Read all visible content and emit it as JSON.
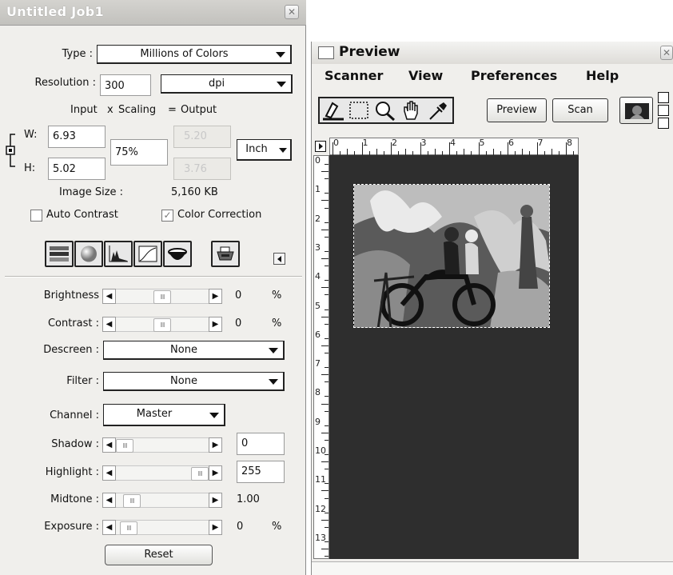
{
  "left_panel": {
    "title": "Untitled Job1",
    "type_label": "Type :",
    "type_value": "Millions of Colors",
    "resolution_label": "Resolution :",
    "resolution_value": "300",
    "resolution_unit": "dpi",
    "formula": {
      "input": "Input",
      "x": "x",
      "scaling": "Scaling",
      "eq": "=",
      "output": "Output"
    },
    "w_label": "W:",
    "w_value": "6.93",
    "h_label": "H:",
    "h_value": "5.02",
    "scaling_value": "75%",
    "output_w": "5.20",
    "output_h": "3.76",
    "unit_value": "Inch",
    "image_size_label": "Image Size :",
    "image_size_value": "5,160 KB",
    "auto_contrast_label": "Auto Contrast",
    "auto_contrast_checked": false,
    "color_correction_label": "Color Correction",
    "color_correction_checked": true,
    "adjustments": [
      {
        "label": "Brightness",
        "value": "0",
        "unit": "%",
        "level": 0.5
      },
      {
        "label": "Contrast :",
        "value": "0",
        "unit": "%",
        "level": 0.5
      }
    ],
    "descreen_label": "Descreen :",
    "descreen_value": "None",
    "filter_label": "Filter :",
    "filter_value": "None",
    "channel_label": "Channel :",
    "channel_value": "Master",
    "levels": [
      {
        "label": "Shadow :",
        "value": "0",
        "level": 0.0
      },
      {
        "label": "Highlight :",
        "value": "255",
        "level": 1.0
      },
      {
        "label": "Midtone :",
        "value": "1.00",
        "level": 0.1
      },
      {
        "label": "Exposure :",
        "value": "0",
        "unit": "%",
        "level": 0.05
      }
    ],
    "reset_label": "Reset",
    "tool_icons": [
      "levels-icon",
      "color-balance-icon",
      "histogram-icon",
      "curves-icon",
      "hue-bowl-icon"
    ],
    "thumb_glyph": "IIII",
    "close_glyph": "✕"
  },
  "preview": {
    "title": "Preview",
    "menus": [
      "Scanner",
      "View",
      "Preferences",
      "Help"
    ],
    "tools": [
      "scanner-eraser-icon",
      "marquee-select-icon",
      "zoom-icon",
      "hand-pan-icon",
      "eyedropper-icon"
    ],
    "preview_button": "Preview",
    "scan_button": "Scan",
    "ruler_top": [
      "0",
      "1",
      "2",
      "3",
      "4",
      "5",
      "6",
      "7",
      "8"
    ],
    "ruler_left": [
      "0",
      "1",
      "2",
      "3",
      "4",
      "5",
      "6",
      "7",
      "8",
      "9",
      "10",
      "11",
      "12",
      "13"
    ],
    "close_glyph": "✕"
  }
}
